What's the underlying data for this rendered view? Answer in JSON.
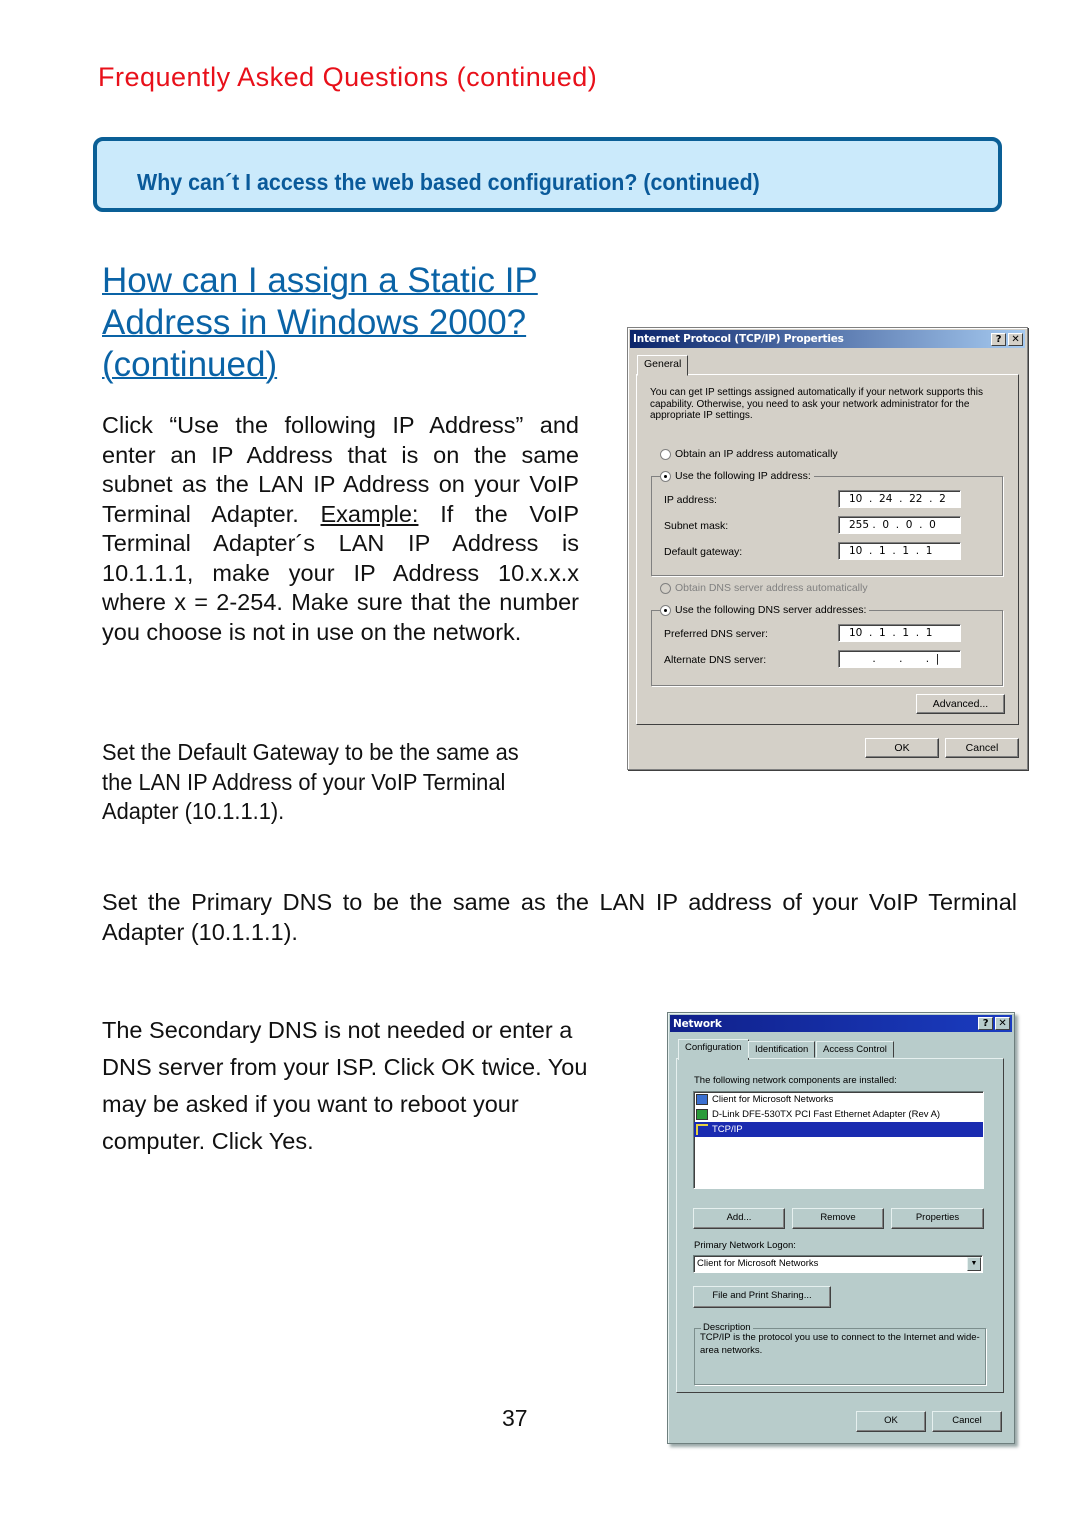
{
  "page": {
    "section_title": "Frequently Asked Questions (continued)",
    "question_box": "Why can´t I access the web based configuration? (continued)",
    "heading": "How can I assign a Static IP Address in Windows 2000? (continued)",
    "paragraph1_before": "Click “Use the following IP Address” and enter an IP Address that is on the same subnet as the LAN IP Address on your VoIP Terminal Adapter. ",
    "paragraph1_example": "Example:",
    "paragraph1_after": " If the VoIP Terminal Adapter´s LAN IP Address is 10.1.1.1, make your IP Address 10.x.x.x where x = 2-254. Make sure that the number you choose is not in use on the network.",
    "paragraph2": "Set the Default Gateway to be the same as the LAN IP Address of your VoIP Terminal Adapter (10.1.1.1).",
    "paragraph3": "Set the Primary DNS to be the same as the LAN IP address of your VoIP Terminal Adapter (10.1.1.1).",
    "paragraph4": "The Secondary DNS is not needed or enter a DNS server from your ISP. Click OK twice. You may be asked if you want to reboot your computer. Click Yes.",
    "page_number": "37",
    "colors": {
      "section_title": "#e8101a",
      "question_box_bg": "#cbeafb",
      "question_box_border": "#0a5f96",
      "heading": "#0a63a6"
    }
  },
  "tcpip_dialog": {
    "title": "Internet Protocol (TCP/IP) Properties",
    "help_button": "?",
    "close_button": "✕",
    "tab": "General",
    "intro": "You can get IP settings assigned automatically if your network supports this capability. Otherwise, you need to ask your network administrator for the appropriate IP settings.",
    "radio_auto_ip": "Obtain an IP address automatically",
    "radio_manual_ip": "Use the following IP address:",
    "ip_label": "IP address:",
    "ip_value": "10  .  24  .  22  .  2",
    "mask_label": "Subnet mask:",
    "mask_value": "255 .  0  .  0  .  0",
    "gateway_label": "Default gateway:",
    "gateway_value": "10  .  1  .  1  .  1",
    "radio_auto_dns": "Obtain DNS server address automatically",
    "radio_manual_dns": "Use the following DNS server addresses:",
    "pref_dns_label": "Preferred DNS server:",
    "pref_dns_value": "10  .  1  .  1  .  1",
    "alt_dns_label": "Alternate DNS server:",
    "alt_dns_value": "       .       .       .  |",
    "advanced_button": "Advanced...",
    "ok_button": "OK",
    "cancel_button": "Cancel"
  },
  "network_dialog": {
    "title": "Network",
    "help_button": "?",
    "close_button": "✕",
    "tabs": [
      "Configuration",
      "Identification",
      "Access Control"
    ],
    "components_label": "The following network components are installed:",
    "components": [
      {
        "icon": "client-icon",
        "label": "Client for Microsoft Networks"
      },
      {
        "icon": "network-adapter-icon",
        "label": "D-Link DFE-530TX PCI Fast Ethernet Adapter (Rev A)"
      },
      {
        "icon": "protocol-icon",
        "label": "TCP/IP"
      }
    ],
    "selected_component": "TCP/IP",
    "add_button": "Add...",
    "remove_button": "Remove",
    "properties_button": "Properties",
    "logon_label": "Primary Network Logon:",
    "logon_value": "Client for Microsoft Networks",
    "file_print_button": "File and Print Sharing...",
    "description_label": "Description",
    "description_text": "TCP/IP is the protocol you use to connect to the Internet and wide-area networks.",
    "ok_button": "OK",
    "cancel_button": "Cancel"
  }
}
